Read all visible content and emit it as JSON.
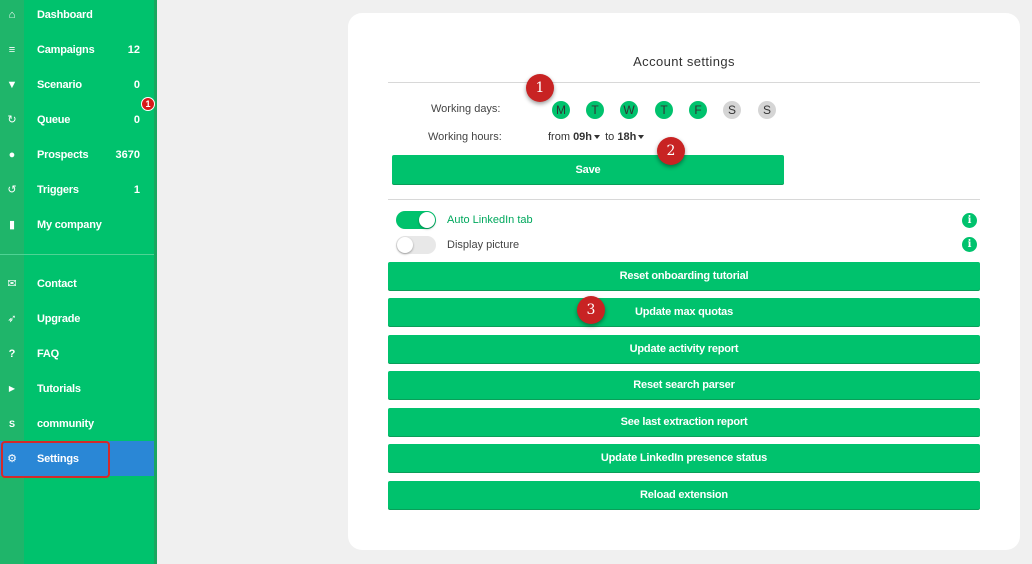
{
  "sidebar": {
    "items_top": [
      {
        "label": "Dashboard",
        "count": "",
        "icon": "home-icon",
        "glyph": "⌂"
      },
      {
        "label": "Campaigns",
        "count": "12",
        "icon": "list-icon",
        "glyph": "≡"
      },
      {
        "label": "Scenario",
        "count": "0",
        "icon": "filter-icon",
        "glyph": "▼"
      },
      {
        "label": "Queue",
        "count": "0",
        "icon": "refresh-icon",
        "glyph": "↻"
      },
      {
        "label": "Prospects",
        "count": "3670",
        "icon": "user-icon",
        "glyph": "●"
      },
      {
        "label": "Triggers",
        "count": "1",
        "icon": "history-icon",
        "glyph": "↺"
      },
      {
        "label": "My company",
        "count": "",
        "icon": "building-icon",
        "glyph": "▮"
      }
    ],
    "items_bottom": [
      {
        "label": "Contact",
        "icon": "envelope-icon",
        "glyph": "✉"
      },
      {
        "label": "Upgrade",
        "icon": "rocket-icon",
        "glyph": "➶"
      },
      {
        "label": "FAQ",
        "icon": "question-icon",
        "glyph": "?"
      },
      {
        "label": "Tutorials",
        "icon": "youtube-icon",
        "glyph": "▶"
      },
      {
        "label": "community",
        "icon": "skype-icon",
        "glyph": "S"
      },
      {
        "label": "Settings",
        "icon": "gear-icon",
        "glyph": "⚙"
      }
    ],
    "queue_badge": "1"
  },
  "card": {
    "title": "Account settings",
    "working_days_label": "Working days:",
    "days": [
      {
        "letter": "M",
        "active": true
      },
      {
        "letter": "T",
        "active": true
      },
      {
        "letter": "W",
        "active": true
      },
      {
        "letter": "T",
        "active": true
      },
      {
        "letter": "F",
        "active": true
      },
      {
        "letter": "S",
        "active": false
      },
      {
        "letter": "S",
        "active": false
      }
    ],
    "working_hours_label": "Working hours:",
    "hours_from_prefix": "from",
    "hours_from": "09h",
    "hours_to_prefix": "to",
    "hours_to": "18h",
    "save_label": "Save",
    "toggles": [
      {
        "label": "Auto LinkedIn tab",
        "on": true
      },
      {
        "label": "Display picture",
        "on": false
      }
    ],
    "info_glyph": "i",
    "buttons": [
      "Reset onboarding tutorial",
      "Update max quotas",
      "Update activity report",
      "Reset search parser",
      "See last extraction report",
      "Update LinkedIn presence status",
      "Reload extension"
    ]
  },
  "markers": [
    "1",
    "2",
    "3"
  ],
  "colors": {
    "brand_green": "#00c26d",
    "active_blue": "#2a87d6",
    "alert_red": "#d71919"
  }
}
